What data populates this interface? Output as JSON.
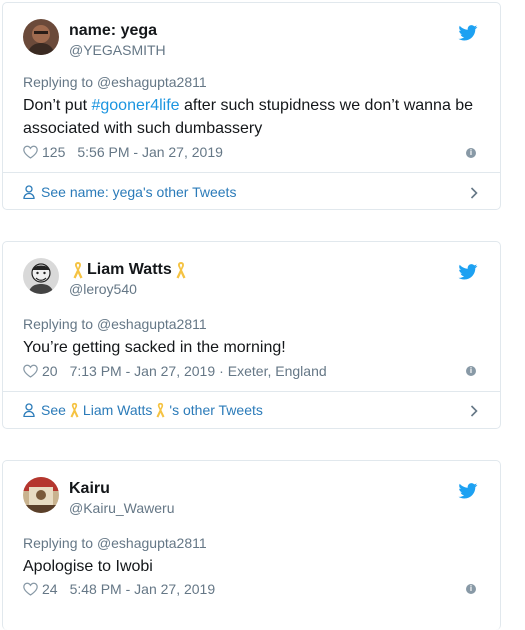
{
  "colors": {
    "accent": "#1b95e0",
    "link": "#2b7bb9",
    "muted": "#657786",
    "ribbon": "#f5c343"
  },
  "tweets": [
    {
      "display_name": "name: yega",
      "handle": "@YEGASMITH",
      "reply_prefix": "Replying to",
      "reply_to": "@eshagupta2811",
      "text_before": "Don’t put ",
      "hashtag": "#gooner4life",
      "text_after": " after such stupidness we don’t wanna be associated with such dumbassery",
      "likes": "125",
      "time": "5:56 PM - Jan 27, 2019",
      "location": "",
      "see_prefix": "See",
      "see_name": "name: yega",
      "see_suffix": "'s other Tweets"
    },
    {
      "display_name": "Liam Watts",
      "handle": "@leroy540",
      "reply_prefix": "Replying to",
      "reply_to": "@eshagupta2811",
      "text": "You’re getting sacked in the morning!",
      "likes": "20",
      "time": "7:13 PM - Jan 27, 2019",
      "location": "Exeter, England",
      "location_sep": "·",
      "see_prefix": "See",
      "see_name": "Liam Watts",
      "see_suffix": "'s other Tweets"
    },
    {
      "display_name": "Kairu",
      "handle": "@Kairu_Waweru",
      "reply_prefix": "Replying to",
      "reply_to": "@eshagupta2811",
      "text": "Apologise to Iwobi",
      "likes": "24",
      "time": "5:48 PM - Jan 27, 2019"
    }
  ],
  "icons": {
    "bird": "twitter-bird-icon",
    "heart": "heart-icon",
    "info": "info-icon",
    "person": "person-icon",
    "chevron": "chevron-right-icon",
    "ribbon": "yellow-ribbon-icon"
  },
  "info_glyph": "i"
}
